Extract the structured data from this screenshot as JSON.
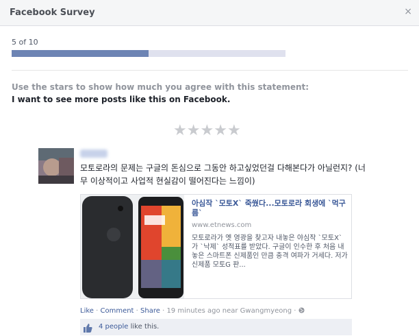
{
  "dialog": {
    "title": "Facebook Survey",
    "close_glyph": "×"
  },
  "progress": {
    "text": "5 of 10",
    "fraction": 0.5
  },
  "question": {
    "instruction": "Use the stars to show how much you agree with this statement:",
    "statement": "I want to see more posts like this on Facebook.",
    "star_glyph": "★",
    "star_count": 5
  },
  "post": {
    "text": "모토로라의 문제는 구글의 돈심으로 그동안 하고싶었던걸 다해본다가 아닐런지? (너무 이상적이고 사업적 현실감이 떨어진다는 느낌이)",
    "link": {
      "title": "아심작 `모토X` 죽쒔다...모토로라 회생에 `먹구름`",
      "domain": "www.etnews.com",
      "description": "모토로라가 옛 영광을 찾고자 내놓은 야심작 `모토X`가 `낙제` 성적표를 받았다. 구글이 인수한 후 처음 내놓은 스마트폰 신제품인 만큼 충격 여파가 거세다. 저가 신제품 모토G 판..."
    },
    "actions": {
      "like": "Like",
      "comment": "Comment",
      "share": "Share",
      "separator": " · ",
      "time": "19 minutes ago near Gwangmyeong",
      "separator2": " · "
    },
    "likes": {
      "count_label": "4 people",
      "suffix": " like this."
    }
  },
  "colors": {
    "accent": "#3b5998",
    "progress_fill": "#6d84b4",
    "progress_track": "#dfe1ee",
    "star_empty": "#c9cbcf"
  }
}
